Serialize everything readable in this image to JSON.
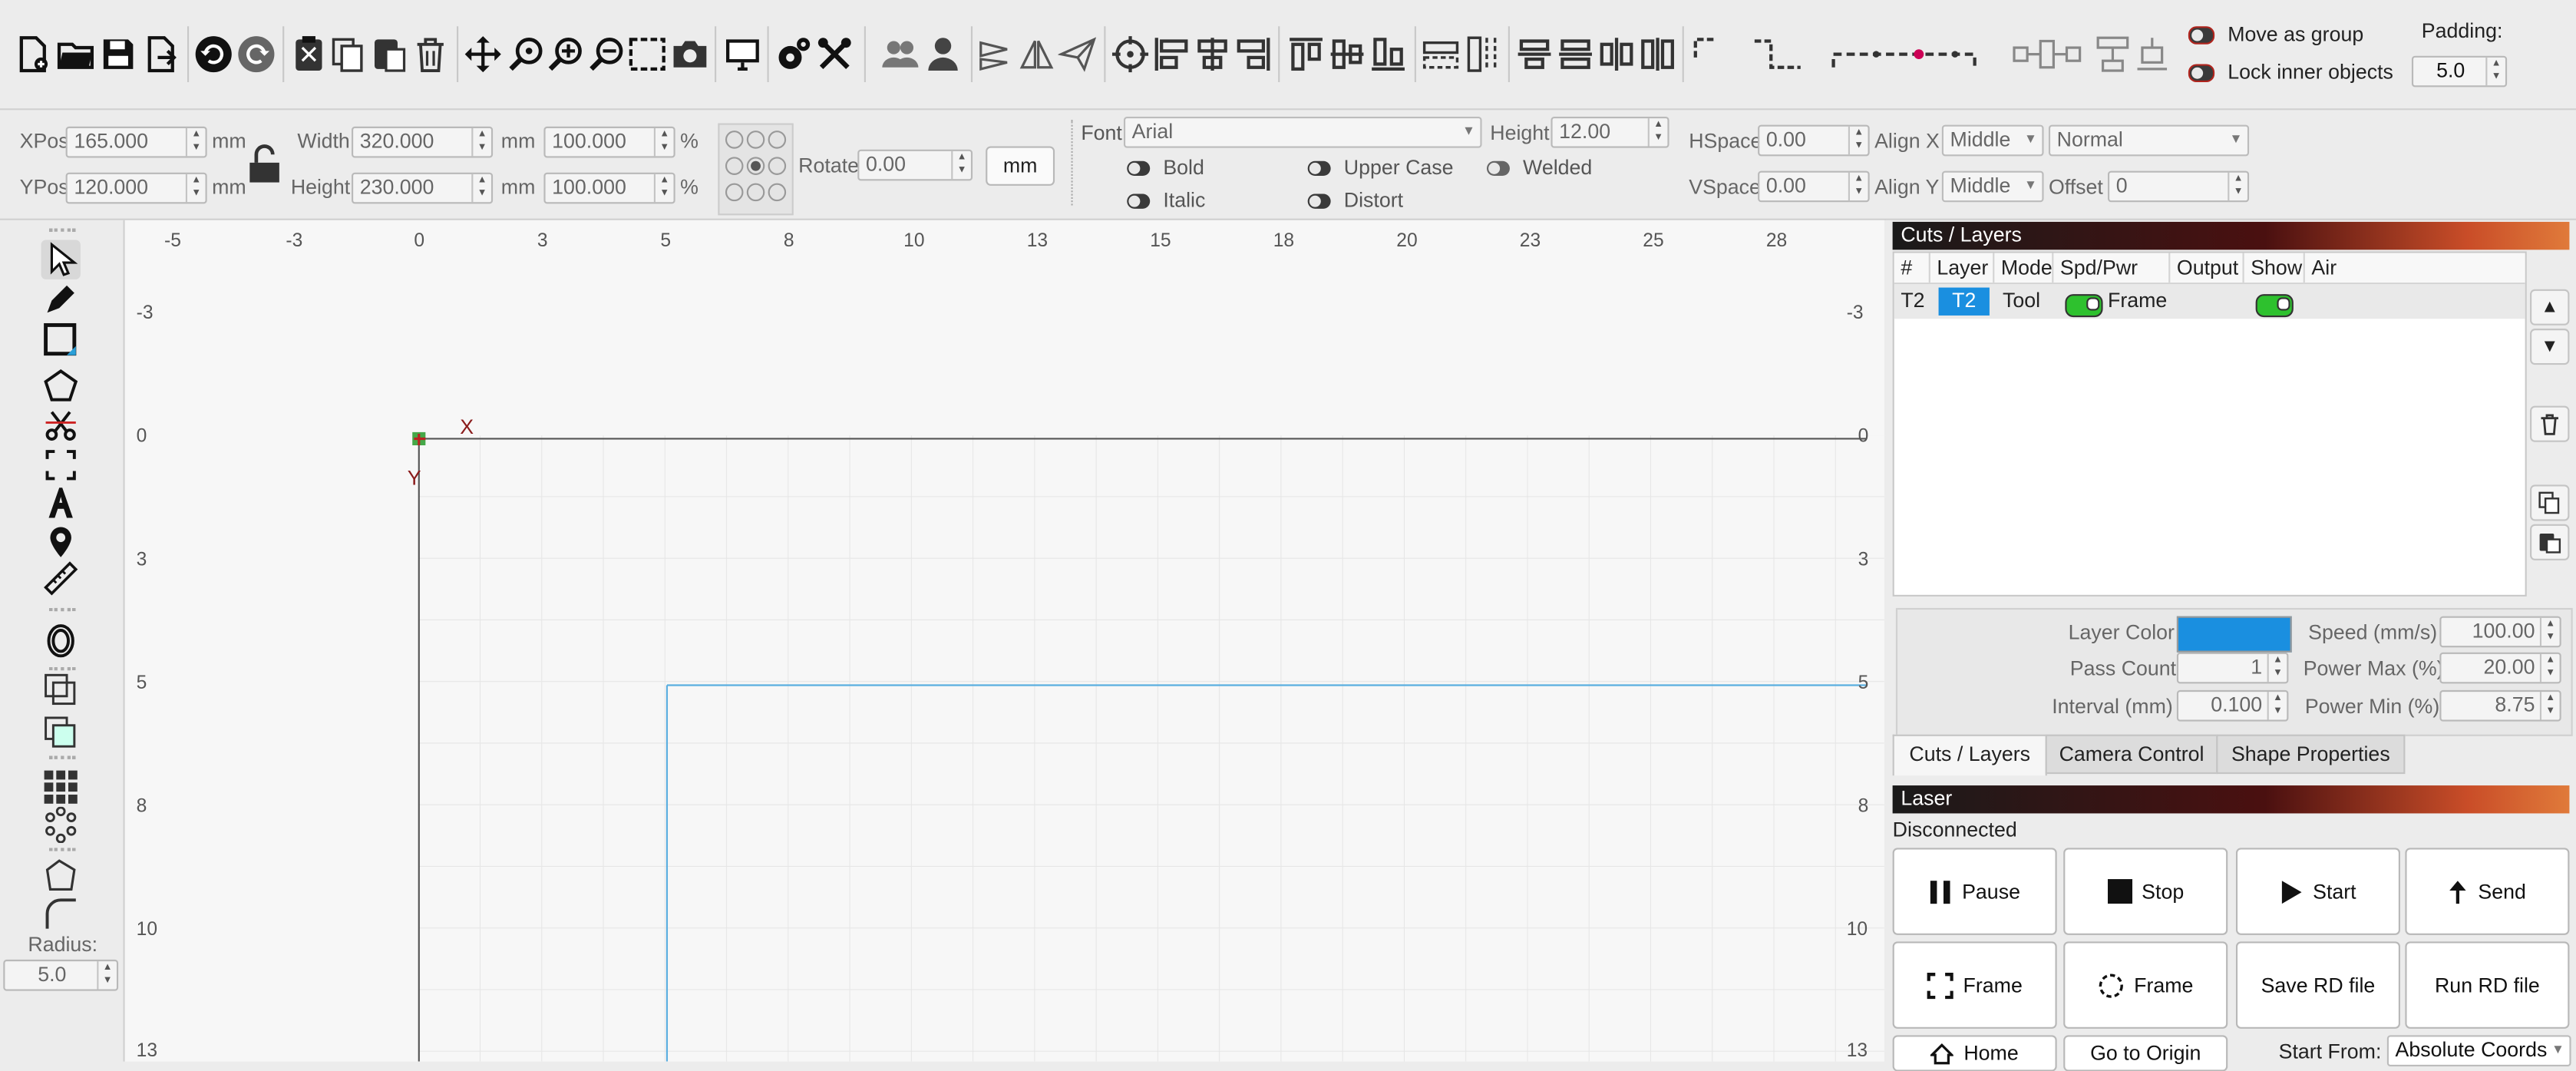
{
  "toolbar": {
    "move_as_group": "Move as group",
    "lock_inner_objects": "Lock inner objects",
    "padding_label": "Padding:",
    "padding_value": "5.0",
    "icons": [
      "new-file-icon",
      "open-folder-icon",
      "save-icon",
      "export-icon",
      "undo-icon",
      "redo-icon",
      "cut-icon",
      "copy-icon",
      "paste-icon",
      "delete-icon",
      "move-icon",
      "zoom-icon",
      "zoom-in-icon",
      "zoom-out-icon",
      "select-rect-icon",
      "camera-icon",
      "monitor-icon",
      "settings-icon",
      "tools-icon",
      "users-icon",
      "user-icon",
      "mirror-h-icon",
      "mirror-v-icon",
      "send-icon",
      "target-icon",
      "align-left-icon",
      "align-center-icon",
      "align-right-icon",
      "align-top-icon",
      "align-middle-icon",
      "align-bottom-icon",
      "distribute-h-icon",
      "distribute-v-icon",
      "space-h-icon",
      "space-v-icon",
      "corner-icon",
      "step-icon",
      "dotted-line-icon",
      "equal-space-icon",
      "equal-size-icon"
    ]
  },
  "propbar": {
    "xpos_label": "XPos",
    "xpos_value": "165.000",
    "ypos_label": "YPos",
    "ypos_value": "120.000",
    "unit": "mm",
    "width_label": "Width",
    "width_value": "320.000",
    "height_label": "Height",
    "height_value": "230.000",
    "width_pct": "100.000",
    "height_pct": "100.000",
    "pct": "%",
    "rotate_label": "Rotate",
    "rotate_value": "0.00",
    "unit_button": "mm",
    "font_label": "Font",
    "font_value": "Arial",
    "font_height_label": "Height",
    "font_height_value": "12.00",
    "bold": "Bold",
    "italic": "Italic",
    "upper_case": "Upper Case",
    "distort": "Distort",
    "welded": "Welded",
    "hspace_label": "HSpace",
    "hspace_value": "0.00",
    "vspace_label": "VSpace",
    "vspace_value": "0.00",
    "align_x_label": "Align X",
    "align_x_value": "Middle",
    "align_y_label": "Align Y",
    "align_y_value": "Middle",
    "style_value": "Normal",
    "offset_label": "Offset",
    "offset_value": "0"
  },
  "lefttools": {
    "icons": [
      "pointer-icon",
      "pen-icon",
      "rectangle-icon",
      "polygon-icon",
      "scissors-icon",
      "frame-icon",
      "text-icon",
      "location-pin-icon",
      "ruler-icon",
      "ellipse-icon",
      "offset-icon",
      "boolean-icon",
      "grid-array-icon",
      "circular-array-icon",
      "node-edit-icon",
      "corner-round-icon"
    ],
    "radius_label": "Radius:",
    "radius_value": "5.0"
  },
  "canvas": {
    "x_ticks": [
      "-5",
      "-3",
      "0",
      "3",
      "5",
      "8",
      "10",
      "13",
      "15",
      "18",
      "20",
      "23",
      "25",
      "28"
    ],
    "y_ticks": [
      "-3",
      "0",
      "3",
      "5",
      "8",
      "10",
      "13"
    ],
    "x_axis": "X",
    "y_axis": "Y"
  },
  "cuts_layers": {
    "title": "Cuts / Layers",
    "columns": [
      "#",
      "Layer",
      "Mode",
      "Spd/Pwr",
      "Output",
      "Show",
      "Air"
    ],
    "row": {
      "num": "T2",
      "layer": "T2",
      "mode": "Tool",
      "spd_pwr": "Frame"
    },
    "layer_color_label": "Layer Color",
    "layer_color": "#1a8fe0",
    "speed_label": "Speed (mm/s)",
    "speed_value": "100.00",
    "pass_count_label": "Pass Count",
    "pass_count_value": "1",
    "power_max_label": "Power Max (%)",
    "power_max_value": "20.00",
    "interval_label": "Interval (mm)",
    "interval_value": "0.100",
    "power_min_label": "Power Min (%)",
    "power_min_value": "8.75",
    "tabs": [
      "Cuts / Layers",
      "Camera Control",
      "Shape Properties"
    ]
  },
  "laser": {
    "title": "Laser",
    "status": "Disconnected",
    "pause": "Pause",
    "stop": "Stop",
    "start": "Start",
    "send": "Send",
    "frame1": "Frame",
    "frame2": "Frame",
    "save_rd": "Save RD file",
    "run_rd": "Run RD file",
    "home": "Home",
    "go_to_origin": "Go to Origin",
    "start_from_label": "Start From:",
    "start_from_value": "Absolute Coords"
  }
}
